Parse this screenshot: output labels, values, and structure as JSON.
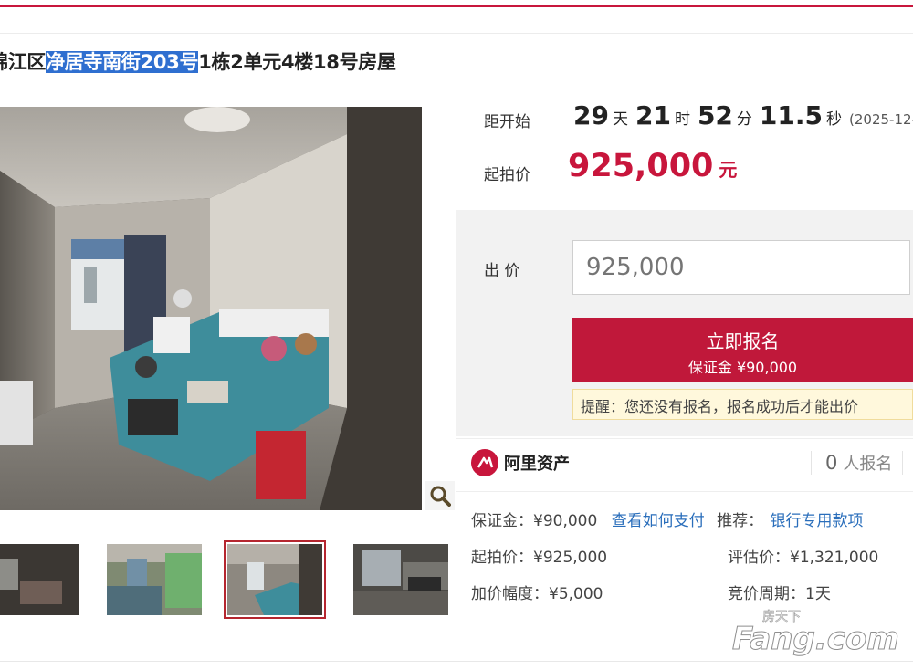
{
  "listing": {
    "title_prefix": "锦江区",
    "title_highlight": "净居寺南街203号",
    "title_suffix": "1栋2单元4楼18号房屋"
  },
  "auction": {
    "countdown_label": "距开始",
    "days": "29",
    "days_unit": "天",
    "hours": "21",
    "hours_unit": "时",
    "minutes": "52",
    "minutes_unit": "分",
    "seconds": "11.5",
    "seconds_unit": "秒",
    "date_partial": "(2025-12-",
    "start_price_label": "起拍价",
    "start_price": "925,000",
    "start_price_unit": "元"
  },
  "bid": {
    "label": "出 价",
    "placeholder": "925,000",
    "signup_button": "立即报名",
    "deposit_line": "保证金 ¥90,000",
    "notice": "提醒：您还没有报名，报名成功后才能出价"
  },
  "org": {
    "name": "阿里资产",
    "signup_count": "0",
    "signup_label": "人报名"
  },
  "details": {
    "deposit": "保证金：¥90,000",
    "how_to_pay": "查看如何支付",
    "recommend_label": "推荐：",
    "bank_account": "银行专用款项",
    "start_price": "起拍价：¥925,000",
    "appraisal": "评估价：¥1,321,000",
    "increment": "加价幅度：¥5,000",
    "cycle": "竞价周期：1天"
  },
  "watermark": {
    "top": "房天下",
    "brand": "Fang.com"
  },
  "colors": {
    "accent": "#c8163c",
    "link": "#2a6ebb",
    "highlight": "#2f6fd0"
  },
  "icons": [
    "zoom-icon",
    "ali-asset-logo-icon"
  ]
}
